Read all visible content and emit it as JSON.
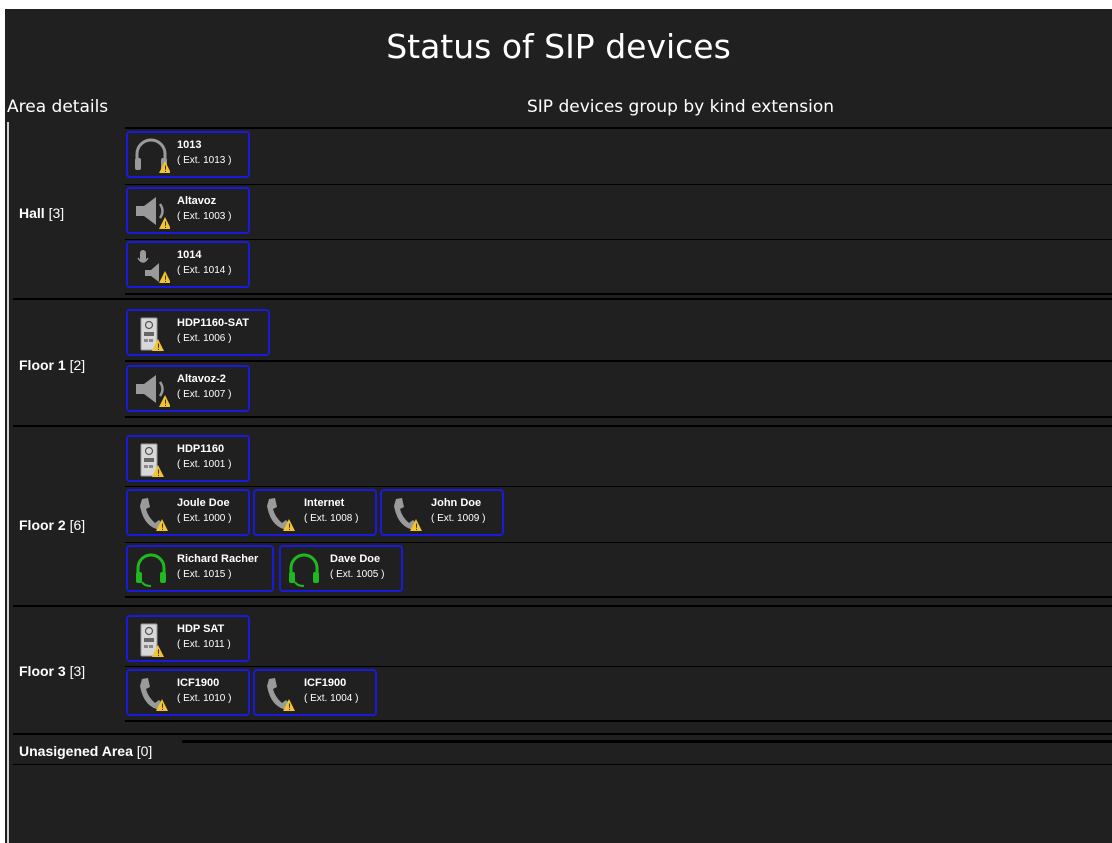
{
  "header": {
    "title": "Status of SIP devices",
    "left_label": "Area details",
    "right_label": "SIP devices group by kind extension"
  },
  "colors": {
    "background": "#202020",
    "card_border": "#1a1adc",
    "warning": "#f3c330",
    "online_green": "#1fb81f",
    "icon_gray": "#9a9a9a"
  },
  "areas": [
    {
      "name": "Hall",
      "count": "[3]"
    },
    {
      "name": "Floor 1",
      "count": "[2]"
    },
    {
      "name": "Floor 2",
      "count": "[6]"
    },
    {
      "name": "Floor 3",
      "count": "[3]"
    },
    {
      "name": "Unasigened Area",
      "count": "[0]"
    }
  ],
  "devices": {
    "d1": {
      "name": "1013",
      "ext": "( Ext. 1013 )",
      "icon": "headset-icon",
      "status": "warning"
    },
    "d2": {
      "name": "Altavoz",
      "ext": "( Ext. 1003 )",
      "icon": "speaker-icon",
      "status": "warning"
    },
    "d3": {
      "name": "1014",
      "ext": "( Ext. 1014 )",
      "icon": "microphone-speaker-icon",
      "status": "warning"
    },
    "d4": {
      "name": "HDP1160-SAT",
      "ext": "( Ext. 1006 )",
      "icon": "door-panel-icon",
      "status": "warning"
    },
    "d5": {
      "name": "Altavoz-2",
      "ext": "( Ext. 1007 )",
      "icon": "speaker-icon",
      "status": "warning"
    },
    "d6": {
      "name": "HDP1160",
      "ext": "( Ext. 1001 )",
      "icon": "door-panel-icon",
      "status": "warning"
    },
    "d7": {
      "name": "Joule Doe",
      "ext": "( Ext. 1000 )",
      "icon": "phone-icon",
      "status": "warning"
    },
    "d8": {
      "name": "Internet",
      "ext": "( Ext. 1008 )",
      "icon": "phone-icon",
      "status": "warning"
    },
    "d9": {
      "name": "John Doe",
      "ext": "( Ext. 1009 )",
      "icon": "phone-icon",
      "status": "warning"
    },
    "d10": {
      "name": "Richard Racher",
      "ext": "( Ext. 1015 )",
      "icon": "headset-icon",
      "status": "online"
    },
    "d11": {
      "name": "Dave Doe",
      "ext": "( Ext. 1005 )",
      "icon": "headset-icon",
      "status": "online"
    },
    "d12": {
      "name": "HDP SAT",
      "ext": "( Ext. 1011 )",
      "icon": "door-panel-icon",
      "status": "warning"
    },
    "d13": {
      "name": "ICF1900",
      "ext": "( Ext. 1010 )",
      "icon": "phone-icon",
      "status": "warning"
    },
    "d14": {
      "name": "ICF1900",
      "ext": "( Ext. 1004 )",
      "icon": "phone-icon",
      "status": "warning"
    }
  }
}
